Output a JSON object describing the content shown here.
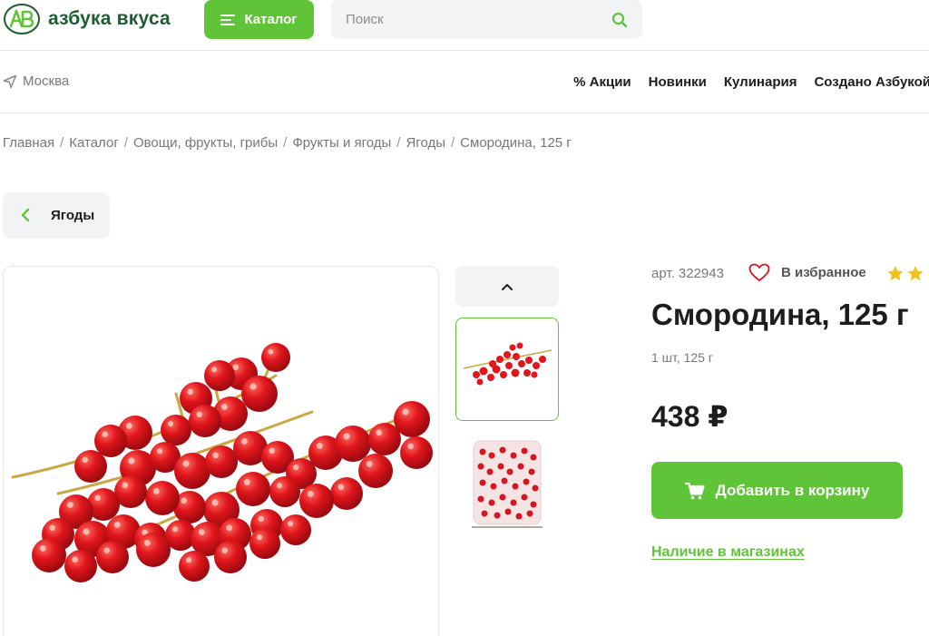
{
  "header": {
    "logo_text": "азбука вкуса",
    "catalog_label": "Каталог",
    "search_placeholder": "Поиск"
  },
  "subnav": {
    "city": "Москва",
    "links": [
      "% Акции",
      "Новинки",
      "Кулинария",
      "Создано Азбукой"
    ]
  },
  "breadcrumb": [
    "Главная",
    "Каталог",
    "Овощи, фрукты, грибы",
    "Фрукты и ягоды",
    "Ягоды",
    "Смородина, 125 г"
  ],
  "back_label": "Ягоды",
  "product": {
    "article": "арт. 322943",
    "favorite_label": "В избранное",
    "rating_stars_visible": 2,
    "title": "Смородина, 125 г",
    "weight": "1 шт, 125 г",
    "price": "438 ₽",
    "add_to_cart": "Добавить в корзину",
    "stock_link": "Наличие в магазинах"
  },
  "colors": {
    "accent": "#5fc438",
    "brand_dark": "#1e5c33",
    "berry": "#d8141c"
  },
  "icons": [
    "logo-mark-icon",
    "menu-icon",
    "search-icon",
    "location-arrow-icon",
    "chevron-left-icon",
    "chevron-up-icon",
    "heart-icon",
    "star-icon",
    "cart-icon"
  ]
}
